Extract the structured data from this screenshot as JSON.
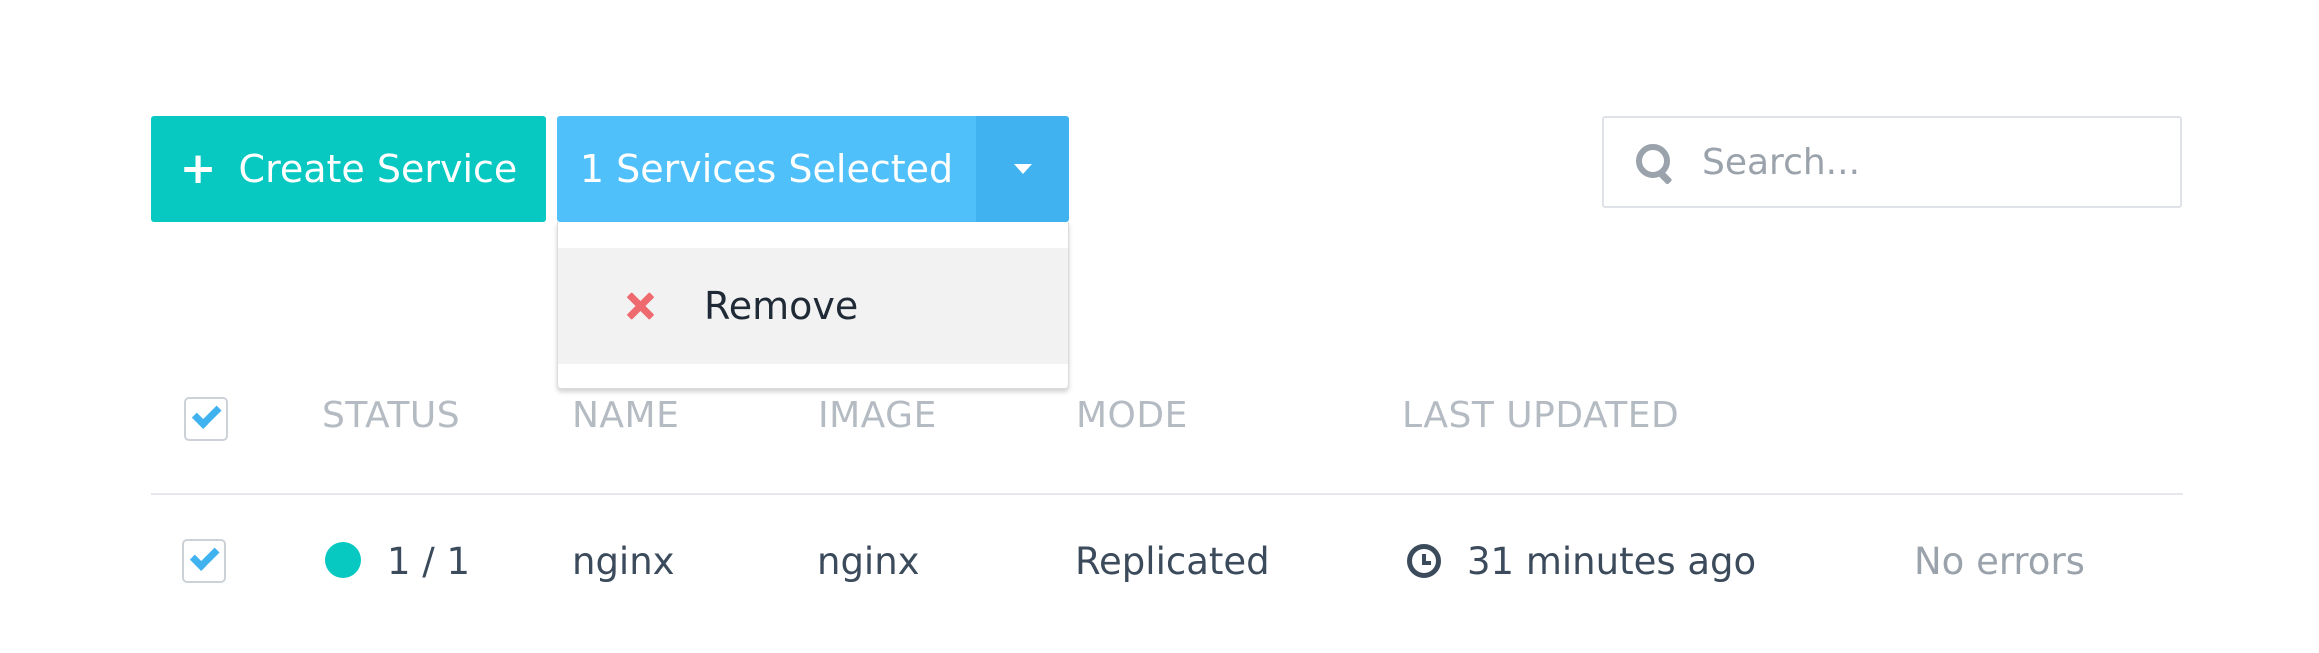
{
  "toolbar": {
    "create_label": "Create Service",
    "selection_label": "1 Services Selected"
  },
  "dropdown": {
    "items": [
      {
        "label": "Remove",
        "icon": "close-icon",
        "icon_color": "#ef6a6e"
      }
    ]
  },
  "search": {
    "placeholder": "Search..."
  },
  "table": {
    "columns": [
      "STATUS",
      "NAME",
      "IMAGE",
      "MODE",
      "LAST UPDATED"
    ],
    "rows": [
      {
        "selected": true,
        "status": "1 / 1",
        "status_color": "#07c9c2",
        "name": "nginx",
        "image": "nginx",
        "mode": "Replicated",
        "last_updated": "31 minutes ago",
        "errors": "No errors"
      }
    ],
    "header_checked": true
  },
  "colors": {
    "accent_teal": "#07c9c2",
    "accent_blue": "#4fc0f9",
    "danger": "#ef6a6e"
  }
}
